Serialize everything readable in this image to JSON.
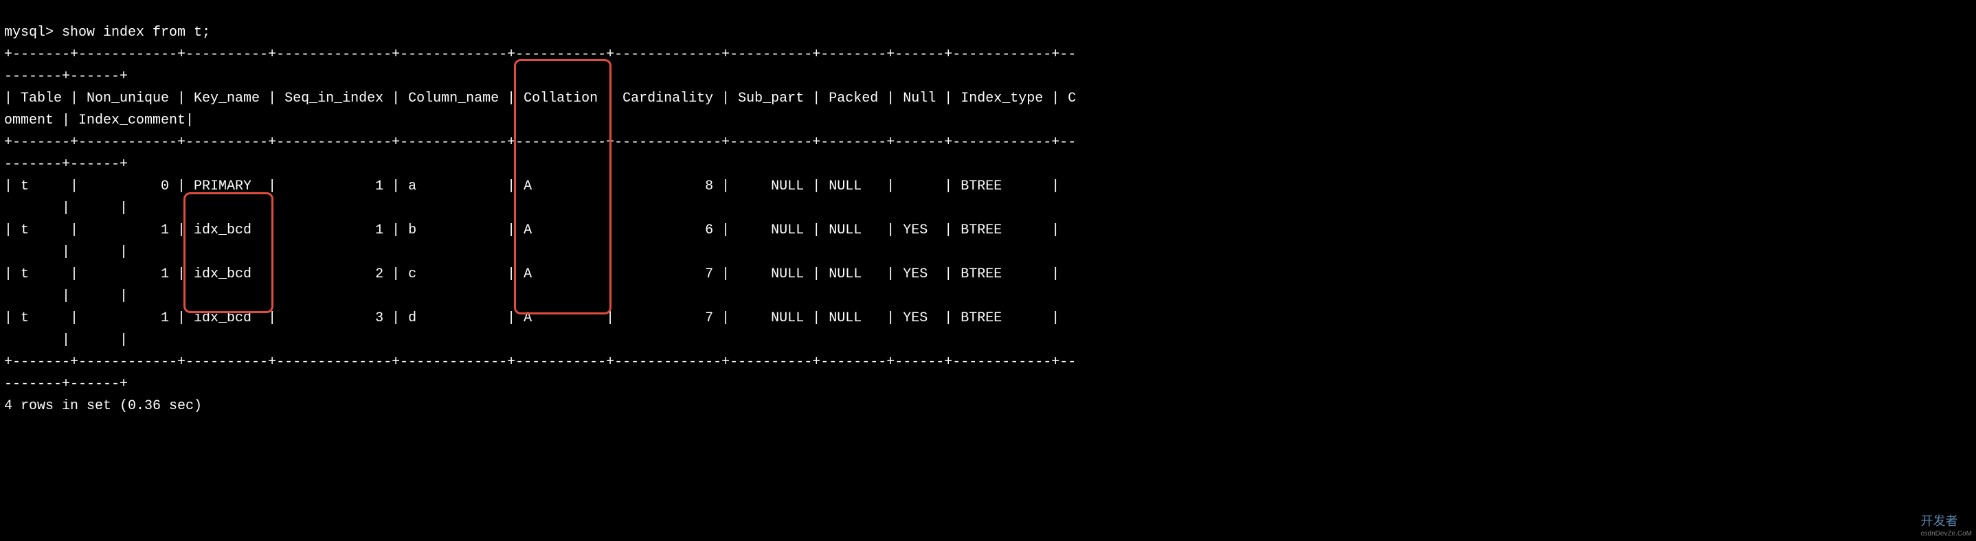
{
  "prompt": "mysql>",
  "command": "show index from t;",
  "headers": [
    "Table",
    "Non_unique",
    "Key_name",
    "Seq_in_index",
    "Column_name",
    "Collation",
    "Cardinality",
    "Sub_part",
    "Packed",
    "Null",
    "Index_type",
    "Comment",
    "Index_comment"
  ],
  "rows": [
    {
      "Table": "t",
      "Non_unique": 0,
      "Key_name": "PRIMARY",
      "Seq_in_index": 1,
      "Column_name": "a",
      "Collation": "A",
      "Cardinality": 8,
      "Sub_part": "NULL",
      "Packed": "NULL",
      "Null": "",
      "Index_type": "BTREE",
      "Comment": "",
      "Index_comment": ""
    },
    {
      "Table": "t",
      "Non_unique": 1,
      "Key_name": "idx_bcd",
      "Seq_in_index": 1,
      "Column_name": "b",
      "Collation": "A",
      "Cardinality": 6,
      "Sub_part": "NULL",
      "Packed": "NULL",
      "Null": "YES",
      "Index_type": "BTREE",
      "Comment": "",
      "Index_comment": ""
    },
    {
      "Table": "t",
      "Non_unique": 1,
      "Key_name": "idx_bcd",
      "Seq_in_index": 2,
      "Column_name": "c",
      "Collation": "A",
      "Cardinality": 7,
      "Sub_part": "NULL",
      "Packed": "NULL",
      "Null": "YES",
      "Index_type": "BTREE",
      "Comment": "",
      "Index_comment": ""
    },
    {
      "Table": "t",
      "Non_unique": 1,
      "Key_name": "idx_bcd",
      "Seq_in_index": 3,
      "Column_name": "d",
      "Collation": "A",
      "Cardinality": 7,
      "Sub_part": "NULL",
      "Packed": "NULL",
      "Null": "YES",
      "Index_type": "BTREE",
      "Comment": "",
      "Index_comment": ""
    }
  ],
  "footer": "4 rows in set (0.36 sec)",
  "watermark_main": "开发者",
  "watermark_sub": "csdnDevZe.CoM",
  "highlights": {
    "key_name_column": "idx_bcd",
    "collation_header": "Collation"
  },
  "column_widths": {
    "Table": 7,
    "Non_unique": 12,
    "Key_name": 10,
    "Seq_in_index": 14,
    "Column_name": 13,
    "Collation": 11,
    "Cardinality": 13,
    "Sub_part": 10,
    "Packed": 8,
    "Null": 6,
    "Index_type": 12,
    "Comment": 9,
    "Index_comment": 6
  },
  "wrap_width": 130
}
